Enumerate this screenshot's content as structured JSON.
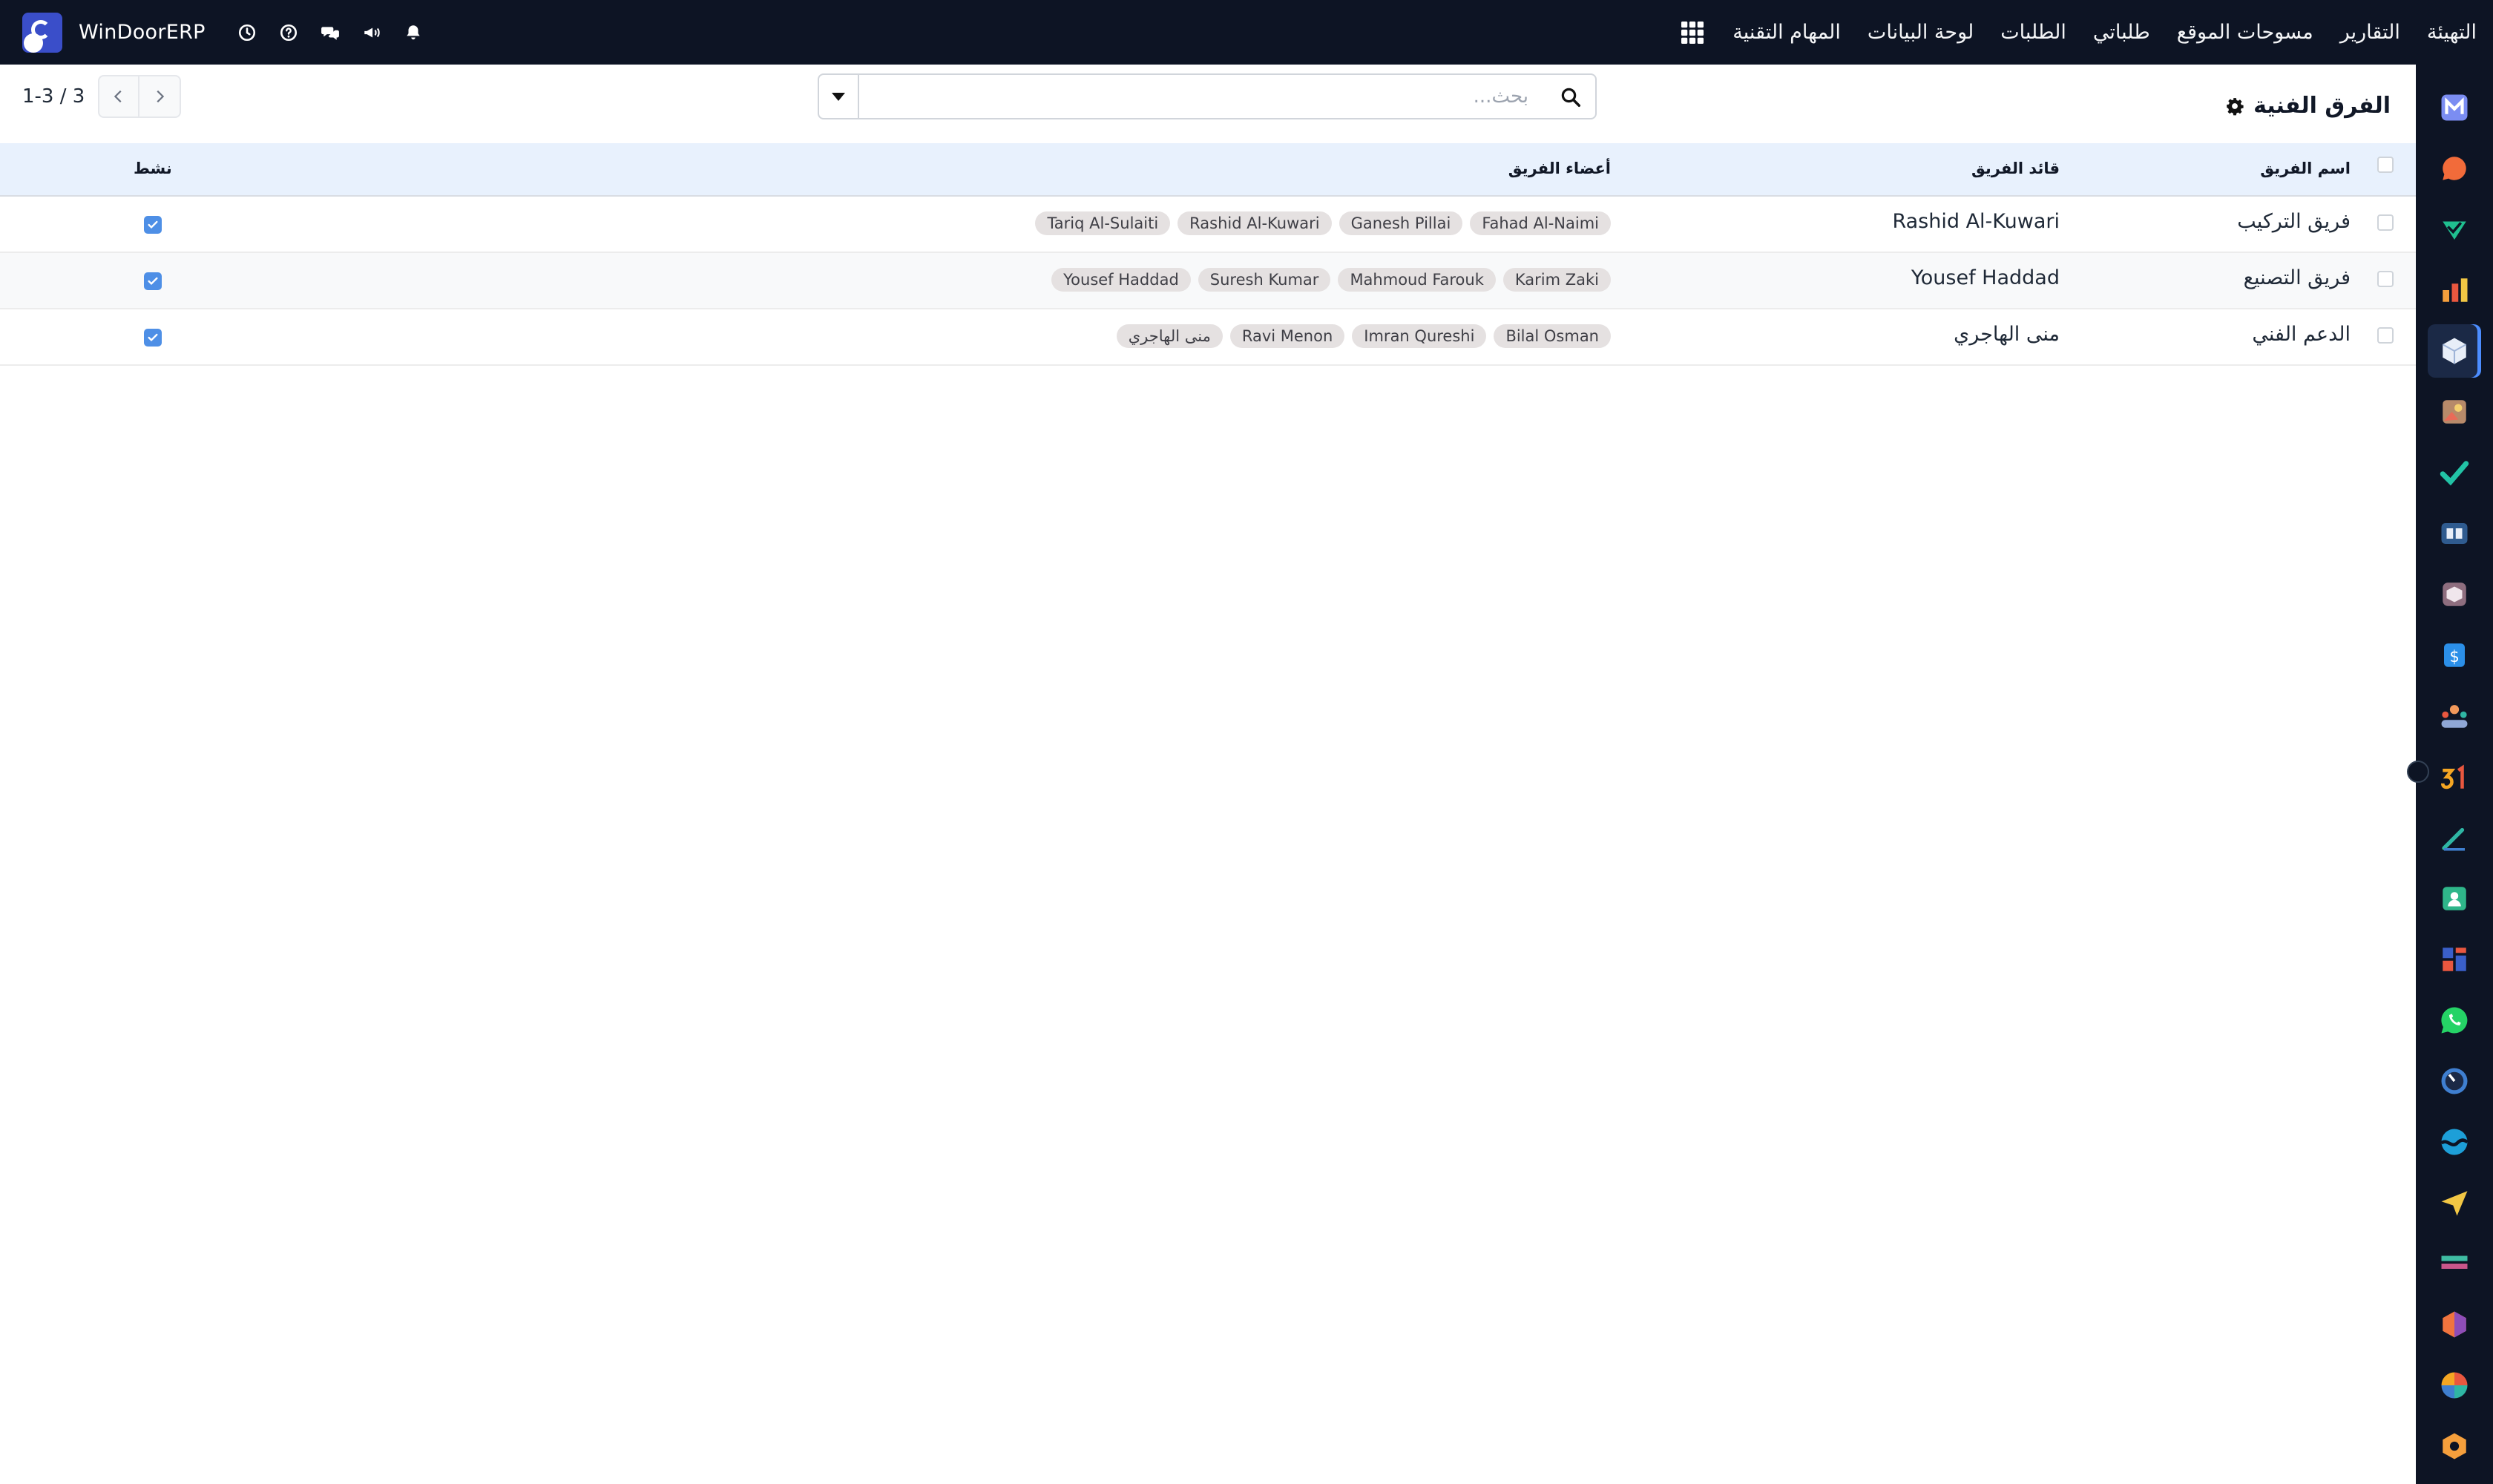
{
  "topbar": {
    "app_name": "WinDoorERP",
    "menu": [
      "المهام التقنية",
      "لوحة البيانات",
      "الطلبات",
      "طلباتي",
      "مسوحات الموقع",
      "التقارير",
      "التهيئة"
    ]
  },
  "control": {
    "title": "الفرق الفنية",
    "search_placeholder": "بحث...",
    "pager": "1-3 / 3"
  },
  "table": {
    "headers": {
      "name": "اسم الفريق",
      "leader": "قائد الفريق",
      "members": "أعضاء الفريق",
      "active": "نشط"
    },
    "rows": [
      {
        "name": "فريق التركيب",
        "leader": "Rashid Al-Kuwari",
        "members": [
          "Fahad Al-Naimi",
          "Ganesh Pillai",
          "Rashid Al-Kuwari",
          "Tariq Al-Sulaiti"
        ],
        "active": true
      },
      {
        "name": "فريق التصنيع",
        "leader": "Yousef Haddad",
        "members": [
          "Karim Zaki",
          "Mahmoud Farouk",
          "Suresh Kumar",
          "Yousef Haddad"
        ],
        "active": true
      },
      {
        "name": "الدعم الفني",
        "leader": "منى الهاجري",
        "members": [
          "Bilal Osman",
          "Imran Qureshi",
          "Ravi Menon",
          "منى الهاجري"
        ],
        "active": true
      }
    ]
  },
  "sidebar": {
    "icons": [
      "mail-m-icon",
      "chat-bubble-icon",
      "pie-check-icon",
      "bar-chart-icon",
      "cube-icon",
      "gallery-icon",
      "task-check-icon",
      "book-icon",
      "package-icon",
      "invoice-icon",
      "team-icon",
      "calendar-31-icon",
      "pen-icon",
      "contacts-icon",
      "dashboard-icon",
      "whatsapp-icon",
      "clock-icon",
      "wave-icon",
      "send-icon",
      "layers-icon",
      "hexagon-icon",
      "pinwheel-icon",
      "box-icon"
    ],
    "active_index": 4
  },
  "colors": {
    "topbar_bg": "#0d1424",
    "header_bg": "#e8f1fd",
    "checkbox_active": "#4e8fe6",
    "tag_bg": "#e5e1e1"
  }
}
